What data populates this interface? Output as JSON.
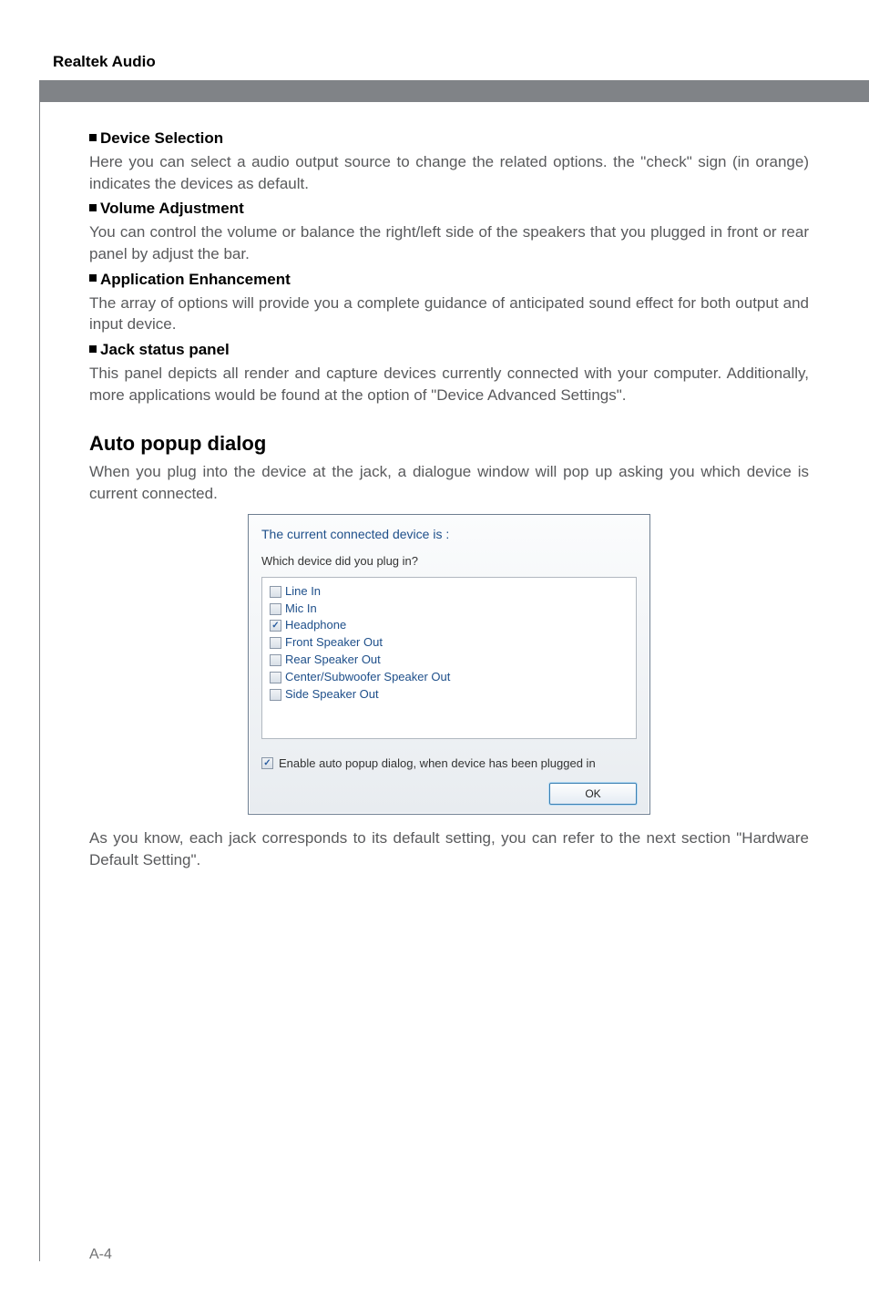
{
  "header": {
    "title": "Realtek Audio"
  },
  "sections": {
    "device_selection": {
      "heading": "Device Selection",
      "body": "Here you can select a audio output source to change the related options. the \"check\" sign (in orange) indicates the devices as default."
    },
    "volume_adjustment": {
      "heading": "Volume Adjustment",
      "body": "You can control the volume or balance the right/left side of the speakers that you plugged in front or rear panel by adjust the bar."
    },
    "application_enhancement": {
      "heading": "Application Enhancement",
      "body": "The array of options will provide you a complete guidance of anticipated sound effect for both output and input device."
    },
    "jack_status": {
      "heading": "Jack status panel",
      "body": "This panel depicts all render and capture devices currently connected with your computer. Additionally, more applications would be found at the option of \"Device Advanced Settings\"."
    }
  },
  "auto_popup": {
    "heading": "Auto popup dialog",
    "intro": "When you plug into the device at the jack, a dialogue window will pop up asking you which device is current connected.",
    "outro": "As you know, each jack corresponds to its default setting, you can refer to the next section \"Hardware Default Setting\"."
  },
  "dialog": {
    "title": "The current connected device is :",
    "prompt": "Which device did you plug in?",
    "devices": [
      {
        "label": "Line In",
        "checked": false
      },
      {
        "label": "Mic In",
        "checked": false
      },
      {
        "label": "Headphone",
        "checked": true
      },
      {
        "label": "Front Speaker Out",
        "checked": false
      },
      {
        "label": "Rear Speaker Out",
        "checked": false
      },
      {
        "label": "Center/Subwoofer Speaker Out",
        "checked": false
      },
      {
        "label": "Side Speaker Out",
        "checked": false
      }
    ],
    "enable_label": "Enable auto popup dialog, when device has been plugged in",
    "enable_checked": true,
    "ok_label": "OK"
  },
  "page_number": "A-4"
}
